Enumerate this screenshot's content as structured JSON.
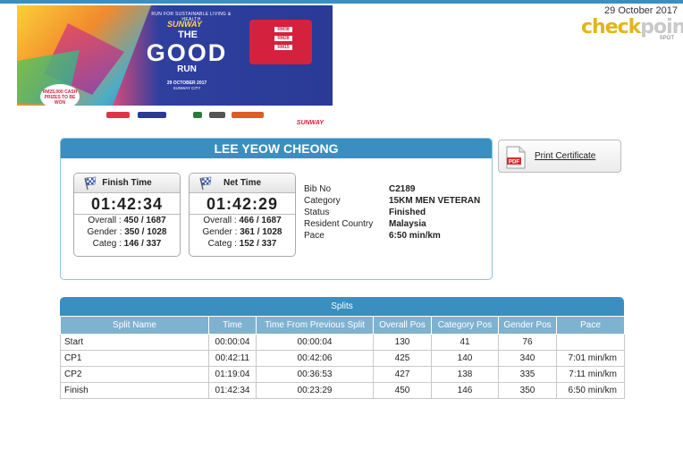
{
  "header": {
    "date": "29 October 2017",
    "brand": {
      "main": "check",
      "accent_split": "point",
      "sub": "SPOT"
    }
  },
  "banner": {
    "kicker": "RUN FOR SUSTAINABLE LIVING & HEALTH",
    "sponsor_top": "SUNWAY",
    "the": "THE",
    "title": "GOOD",
    "run": "RUN",
    "event_date": "29 OCTOBER 2017",
    "venue": "SUNWAY CITY",
    "prices": [
      "RM38",
      "RM28",
      "RM15"
    ],
    "cash": "RM25,000 CASH PRIZES TO BE WON",
    "sponsor_bottom": "SUNWAY"
  },
  "participant": {
    "name": "LEE YEOW CHEONG",
    "finish": {
      "label": "Finish Time",
      "time": "01:42:34",
      "overall_label": "Overall :",
      "overall": "450 / 1687",
      "gender_label": "Gender :",
      "gender": "350 / 1028",
      "categ_label": "Categ :",
      "categ": "146 / 337"
    },
    "net": {
      "label": "Net Time",
      "time": "01:42:29",
      "overall_label": "Overall :",
      "overall": "466 / 1687",
      "gender_label": "Gender :",
      "gender": "361 / 1028",
      "categ_label": "Categ :",
      "categ": "152 / 337"
    },
    "info": [
      {
        "key": "Bib No",
        "value": "C2189"
      },
      {
        "key": "Category",
        "value": "15KM MEN VETERAN"
      },
      {
        "key": "Status",
        "value": "Finished"
      },
      {
        "key": "Resident Country",
        "value": "Malaysia"
      },
      {
        "key": "Pace",
        "value": "6:50 min/km"
      }
    ]
  },
  "print": {
    "label": "Print Certificate",
    "icon": "pdf-icon",
    "icon_text": "PDF"
  },
  "splits": {
    "title": "Splits",
    "columns": [
      "Split Name",
      "Time",
      "Time From Previous Split",
      "Overall Pos",
      "Category Pos",
      "Gender Pos",
      "Pace"
    ],
    "rows": [
      [
        "Start",
        "00:00:04",
        "00:00:04",
        "130",
        "41",
        "76",
        ""
      ],
      [
        "CP1",
        "00:42:11",
        "00:42:06",
        "425",
        "140",
        "340",
        "7:01 min/km"
      ],
      [
        "CP2",
        "01:19:04",
        "00:36:53",
        "427",
        "138",
        "335",
        "7:11 min/km"
      ],
      [
        "Finish",
        "01:42:34",
        "00:23:29",
        "450",
        "146",
        "350",
        "6:50 min/km"
      ]
    ]
  },
  "colors": {
    "accent": "#3a8fc0",
    "header_row": "#7fb2cf",
    "brand_yellow": "#e2b619"
  }
}
